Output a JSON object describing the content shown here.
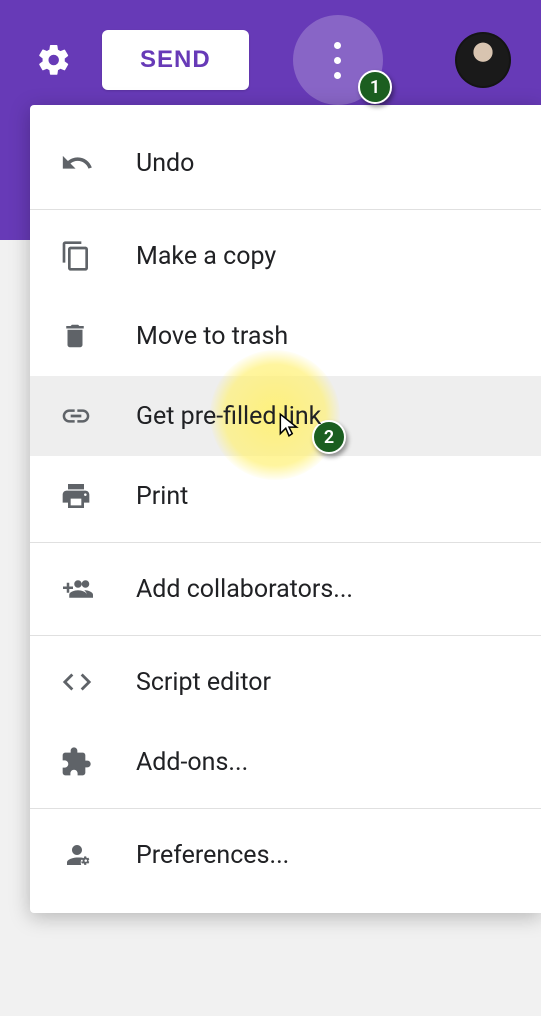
{
  "header": {
    "send_label": "SEND"
  },
  "menu": {
    "undo": "Undo",
    "make_copy": "Make a copy",
    "move_trash": "Move to trash",
    "prefilled": "Get pre-filled link",
    "print": "Print",
    "collaborators": "Add collaborators...",
    "script_editor": "Script editor",
    "addons": "Add-ons...",
    "preferences": "Preferences..."
  },
  "annotations": {
    "badge1": "1",
    "badge2": "2"
  }
}
